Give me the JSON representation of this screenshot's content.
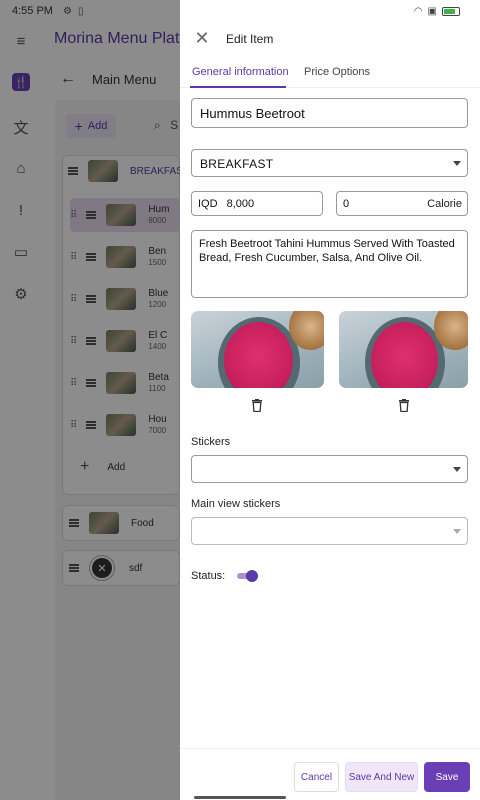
{
  "status_bar": {
    "time": "4:55 PM"
  },
  "background": {
    "app_title": "Morina Menu Platfo",
    "back_label": "Main Menu",
    "add_label": "Add",
    "search_hint": "S",
    "category": "BREAKFAS",
    "items": [
      {
        "name": "Hum",
        "price": "8000"
      },
      {
        "name": "Ben",
        "price": "1500"
      },
      {
        "name": "Blue",
        "price": "1200"
      },
      {
        "name": "El C",
        "price": "1400"
      },
      {
        "name": "Beta",
        "price": "1100"
      },
      {
        "name": "Hou",
        "price": "7000"
      }
    ],
    "add_item_label": "Add",
    "rows": [
      "Food",
      "sdf"
    ]
  },
  "drawer": {
    "title": "Edit Item",
    "tabs": [
      "General information",
      "Price Options"
    ],
    "item_name": "Hummus Beetroot",
    "category_value": "BREAKFAST",
    "currency": "IQD",
    "price": "8,000",
    "calorie_value": "0",
    "calorie_unit": "Calorie",
    "description": "Fresh Beetroot Tahini Hummus Served With Toasted Bread, Fresh Cucumber, Salsa, And Olive Oil.",
    "stickers_label": "Stickers",
    "main_view_stickers_label": "Main view stickers",
    "status_label": "Status:",
    "status_on": true,
    "buttons": {
      "cancel": "Cancel",
      "save_and_new": "Save And New",
      "save": "Save"
    }
  },
  "colors": {
    "accent": "#6a3fb5",
    "accent_light": "#f0e6f7"
  }
}
